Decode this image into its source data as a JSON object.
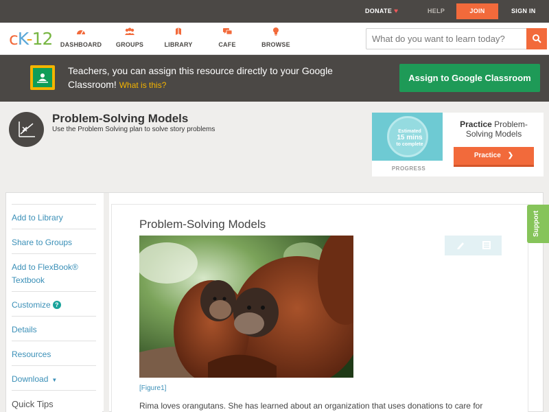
{
  "topbar": {
    "donate": "DONATE",
    "help": "HELP",
    "join": "JOIN",
    "signin": "SIGN IN"
  },
  "logo": {
    "c": "c",
    "k": "K",
    "dash": "-",
    "n": "12"
  },
  "nav": {
    "dashboard": "DASHBOARD",
    "groups": "GROUPS",
    "library": "LIBRARY",
    "cafe": "CAFE",
    "browse": "BROWSE"
  },
  "search": {
    "placeholder": "What do you want to learn today?"
  },
  "classroom_banner": {
    "text": "Teachers, you can assign this resource directly to your Google Classroom!",
    "what_link": "What is this?",
    "button": "Assign to Google Classroom"
  },
  "concept": {
    "title": "Problem-Solving Models",
    "subtitle": "Use the Problem Solving plan to solve story problems"
  },
  "practice_card": {
    "estimated": "Estimated",
    "minutes": "15 mins",
    "to_complete": "to complete",
    "progress_label": "PROGRESS",
    "title_bold": "Practice",
    "title_rest": "Problem-Solving Models",
    "button": "Practice"
  },
  "sidebar": {
    "add_library": "Add to Library",
    "share_groups": "Share to Groups",
    "add_flexbook": "Add to FlexBook® Textbook",
    "customize": "Customize",
    "details": "Details",
    "resources": "Resources",
    "download": "Download",
    "quick_tips": "Quick Tips"
  },
  "article": {
    "title": "Problem-Solving Models",
    "figure_caption": "[Figure1]",
    "body": "Rima loves orangutans. She has learned about an organization that uses donations to care for"
  },
  "support": "Support",
  "colors": {
    "accent": "#f26a3b",
    "dark_bar": "#4b4845",
    "classroom_green": "#1e9a57",
    "link_blue": "#3a8fb7",
    "support_green": "#86c45a"
  }
}
